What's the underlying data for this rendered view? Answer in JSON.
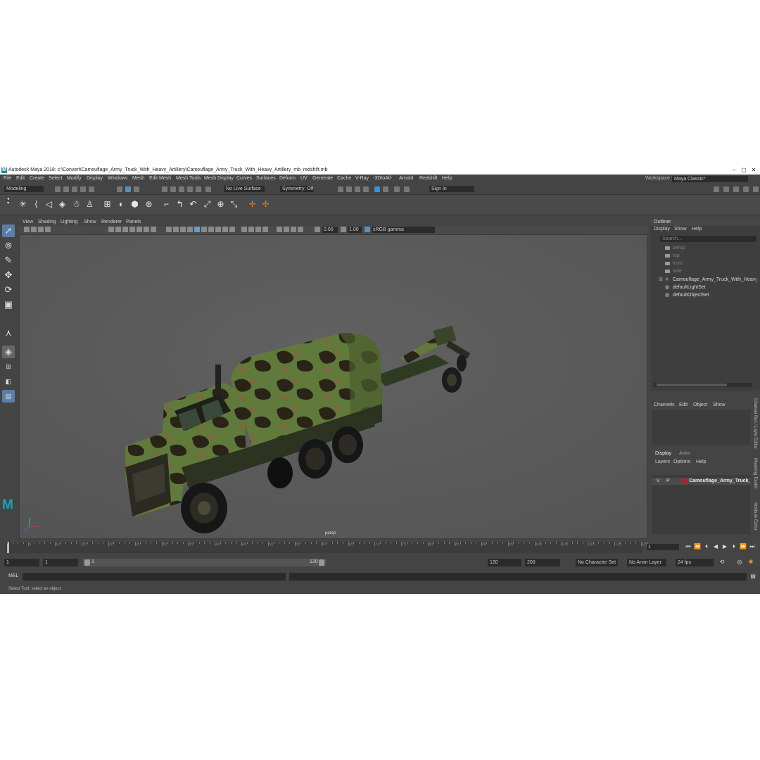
{
  "title": "Autodesk Maya 2018: c:\\Convert\\Camouflage_Army_Truck_With_Heavy_Artillery\\Camouflage_Army_Truck_With_Heavy_Artillery_mb_redshift.mb",
  "logo_letter": "M",
  "window_controls": {
    "minimize": "–",
    "maximize": "▢",
    "close": "✕"
  },
  "menu": [
    "File",
    "Edit",
    "Create",
    "Select",
    "Modify",
    "Display",
    "Windows",
    "Mesh",
    "Edit Mesh",
    "Mesh Tools",
    "Mesh Display",
    "Curves",
    "Surfaces",
    "Deform",
    "UV",
    "Generate",
    "Cache",
    "V-Ray",
    "-3DtoAll-",
    "Arnold",
    "Redshift",
    "Help"
  ],
  "workspace": {
    "label": "Workspace :",
    "value": "Maya Classic*"
  },
  "status": {
    "mode": "Modeling",
    "live_surface": "No Live Surface",
    "symmetry": "Symmetry: Off",
    "sign_in": "Sign In"
  },
  "viewport": {
    "menu": [
      "View",
      "Shading",
      "Lighting",
      "Show",
      "Renderer",
      "Panels"
    ],
    "exposure": "0.00",
    "gamma": "1.00",
    "colorspace": "sRGB gamma",
    "camera_label": "persp"
  },
  "outliner": {
    "title": "Outliner",
    "menu": [
      "Display",
      "Show",
      "Help"
    ],
    "search_placeholder": "Search...",
    "items": [
      {
        "label": "persp",
        "dim": true
      },
      {
        "label": "top",
        "dim": true
      },
      {
        "label": "front",
        "dim": true
      },
      {
        "label": "side",
        "dim": true
      },
      {
        "label": "Camouflage_Army_Truck_With_Heavy_Ar",
        "dim": false
      },
      {
        "label": "defaultLightSet",
        "dim": false
      },
      {
        "label": "defaultObjectSet",
        "dim": false
      }
    ]
  },
  "channel_box": {
    "menu": [
      "Channels",
      "Edit",
      "Object",
      "Show"
    ]
  },
  "layer_editor": {
    "tabs": [
      "Display",
      "Anim"
    ],
    "menu": [
      "Layers",
      "Options",
      "Help"
    ],
    "layer": {
      "v": "V",
      "p": "P",
      "name": "Camouflage_Army_Truck_With_",
      "color": "#b0203a"
    }
  },
  "side_tabs": [
    "Channel Box / Layer Editor",
    "Modeling Toolkit",
    "Attribute Editor"
  ],
  "timeline": {
    "ticks": [
      "5",
      "10",
      "15",
      "20",
      "25",
      "30",
      "35",
      "40",
      "45",
      "50",
      "55",
      "60",
      "65",
      "70",
      "75",
      "80",
      "85",
      "90",
      "95",
      "100",
      "105",
      "110",
      "115",
      "120"
    ],
    "current_frame": "1"
  },
  "range": {
    "start": "1",
    "playback_start": "1",
    "slider_start": "1",
    "slider_end": "120",
    "playback_end": "120",
    "end": "200",
    "character_set": "No Character Set",
    "anim_layer": "No Anim Layer",
    "fps": "24 fps"
  },
  "command": {
    "label": "MEL"
  },
  "help_line": "Select Tool: select an object"
}
